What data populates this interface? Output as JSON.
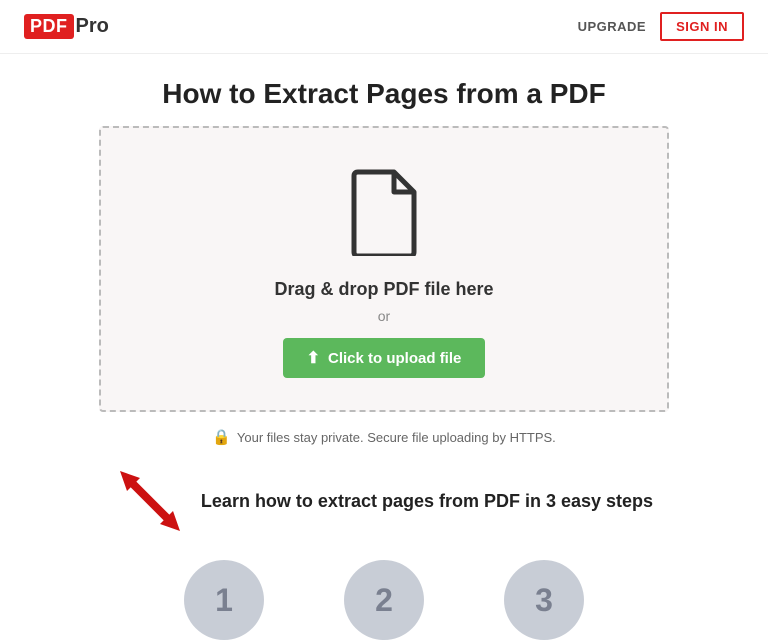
{
  "header": {
    "logo_pdf": "PDF",
    "logo_pro": "Pro",
    "upgrade_label": "UPGRADE",
    "signin_label": "SIGN IN"
  },
  "main": {
    "page_title": "How to Extract Pages from a PDF",
    "upload_area": {
      "drag_drop_text": "Drag & drop PDF file here",
      "or_text": "or",
      "upload_btn_label": "Click to upload file"
    },
    "secure_message": "Your files stay private. Secure file uploading by HTTPS.",
    "steps_section": {
      "steps_title": "Learn how to extract pages from PDF in 3 easy steps",
      "steps": [
        {
          "number": "1"
        },
        {
          "number": "2"
        },
        {
          "number": "3"
        }
      ]
    }
  }
}
